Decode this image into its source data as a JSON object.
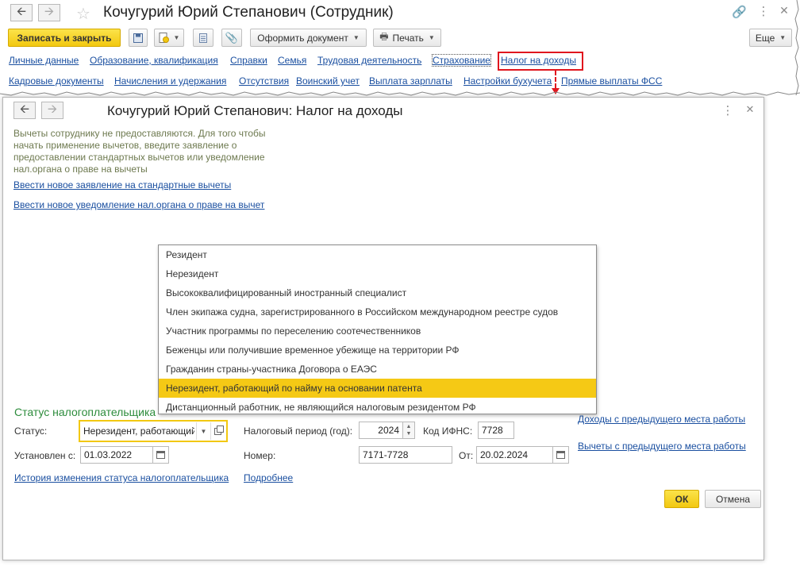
{
  "back_window": {
    "title": "Кочугурий Юрий Степанович (Сотрудник)",
    "toolbar": {
      "save_close": "Записать и закрыть",
      "create_document": "Оформить документ",
      "print": "Печать",
      "more": "Еще"
    },
    "nav_row1": [
      "Личные данные",
      "Образование, квалификация",
      "Справки",
      "Семья",
      "Трудовая деятельность",
      "Страхование",
      "Налог на доходы"
    ],
    "nav_row2": [
      "Кадровые документы",
      "Начисления и удержания",
      "Отсутствия",
      "Воинский учет",
      "Выплата зарплаты",
      "Настройки бухучета",
      "Прямые выплаты ФСС"
    ],
    "highlight_color": "#e0161e"
  },
  "dialog": {
    "title": "Кочугурий Юрий Степанович: Налог на доходы",
    "hint": "Вычеты сотруднику не предоставляются. Для того чтобы начать применение вычетов, введите заявление о предоставлении стандартных вычетов или уведомление нал.органа о праве на вычеты",
    "link_standard": "Ввести новое заявление на стандартные вычеты",
    "link_notice": "Ввести новое уведомление нал.органа о праве на вычет",
    "section_title": "Статус налогоплательщика",
    "status_label": "Статус:",
    "status_value": "Нерезидент, работающий по найму на основании патента",
    "established_label": "Установлен с:",
    "established_value": "01.03.2022",
    "period_label": "Налоговый период (год):",
    "period_value": "2024",
    "ifns_label": "Код ИФНС:",
    "ifns_value": "7728",
    "number_label": "Номер:",
    "number_value": "7171-7728",
    "from_label": "От:",
    "from_value": "20.02.2024",
    "link_history": "История изменения статуса налогоплательщика",
    "link_more": "Подробнее",
    "link_prev_income": "Доходы с предыдущего места работы",
    "link_prev_deductions": "Вычеты с предыдущего места работы",
    "ok": "ОК",
    "cancel": "Отмена"
  },
  "dropdown": {
    "items": [
      "Резидент",
      "Нерезидент",
      "Высококвалифицированный иностранный специалист",
      "Член экипажа судна, зарегистрированного в Российском международном реестре судов",
      "Участник программы по переселению соотечественников",
      "Беженцы или получившие временное убежище на территории РФ",
      "Гражданин страны-участника Договора о ЕАЭС",
      "Нерезидент, работающий по найму на основании патента",
      "Дистанционный работник, не являющийся налоговым резидентом РФ"
    ],
    "selected": "Нерезидент, работающий по найму на основании патента",
    "selected_color": "#f5c915"
  },
  "icons": [
    "arrow-left-icon",
    "arrow-right-icon",
    "star-icon",
    "link-icon",
    "more-vertical-icon",
    "close-icon",
    "save-icon",
    "doc-add-icon",
    "list-icon",
    "attach-icon",
    "printer-icon",
    "calendar-icon",
    "open-form-icon"
  ]
}
